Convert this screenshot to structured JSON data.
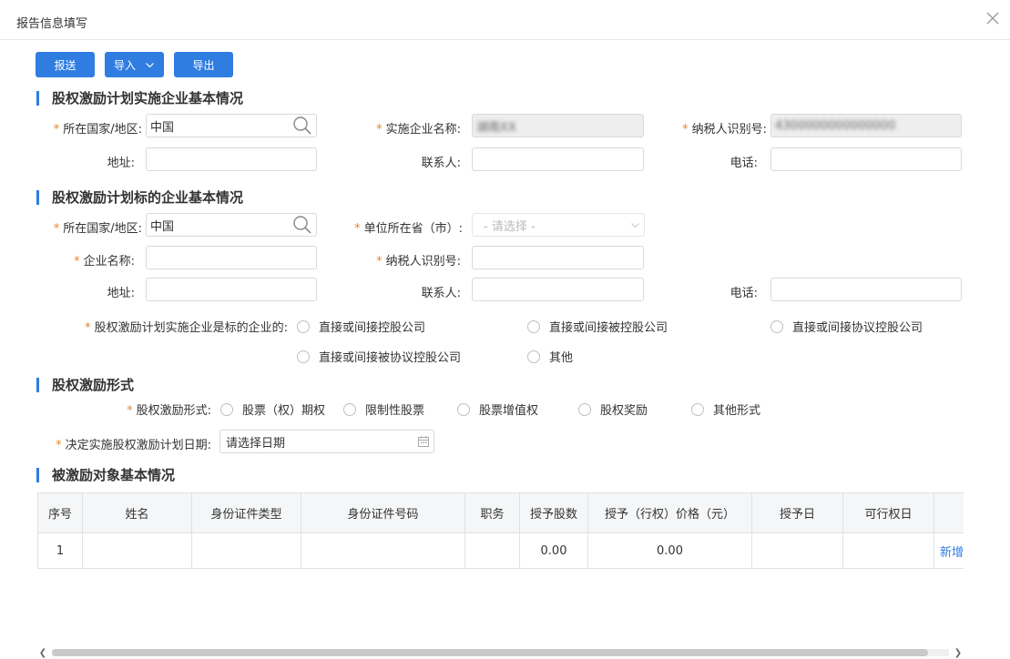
{
  "dialog": {
    "title": "报告信息填写",
    "close_icon": "close-icon"
  },
  "toolbar": {
    "report_label": "报送",
    "import_label": "导入",
    "export_label": "导出"
  },
  "section1": {
    "title": "股权激励计划实施企业基本情况",
    "country_label": "所在国家/地区:",
    "country_value": "中国",
    "company_name_label": "实施企业名称:",
    "company_name_value": "湖南XX",
    "taxpayer_id_label": "纳税人识别号:",
    "taxpayer_id_value": "4300000000000000",
    "address_label": "地址:",
    "contact_label": "联系人:",
    "phone_label": "电话:"
  },
  "section2": {
    "title": "股权激励计划标的企业基本情况",
    "country_label": "所在国家/地区:",
    "country_value": "中国",
    "province_label": "单位所在省（市）:",
    "province_placeholder": "- 请选择 -",
    "company_name_label": "企业名称:",
    "taxpayer_id_label": "纳税人识别号:",
    "address_label": "地址:",
    "contact_label": "联系人:",
    "phone_label": "电话:",
    "relation_label": "股权激励计划实施企业是标的企业的:",
    "relation_options": [
      "直接或间接控股公司",
      "直接或间接被控股公司",
      "直接或间接协议控股公司",
      "直接或间接被协议控股公司",
      "其他"
    ]
  },
  "section3": {
    "title": "股权激励形式",
    "form_label": "股权激励形式:",
    "form_options": [
      "股票（权）期权",
      "限制性股票",
      "股票增值权",
      "股权奖励",
      "其他形式"
    ],
    "date_label": "决定实施股权激励计划日期:",
    "date_placeholder": "请选择日期"
  },
  "section4": {
    "title": "被激励对象基本情况",
    "columns": [
      "序号",
      "姓名",
      "身份证件类型",
      "身份证件号码",
      "职务",
      "授予股数",
      "授予（行权）价格（元）",
      "授予日",
      "可行权日",
      ""
    ],
    "rows": [
      {
        "no": "1",
        "name": "",
        "id_type": "",
        "id_number": "",
        "position": "",
        "shares": "0.00",
        "price": "0.00",
        "grant_date": "",
        "exercise_date": "",
        "action": "新增"
      }
    ]
  },
  "colors": {
    "accent": "#2f7de1",
    "required_star": "#e6862e"
  }
}
